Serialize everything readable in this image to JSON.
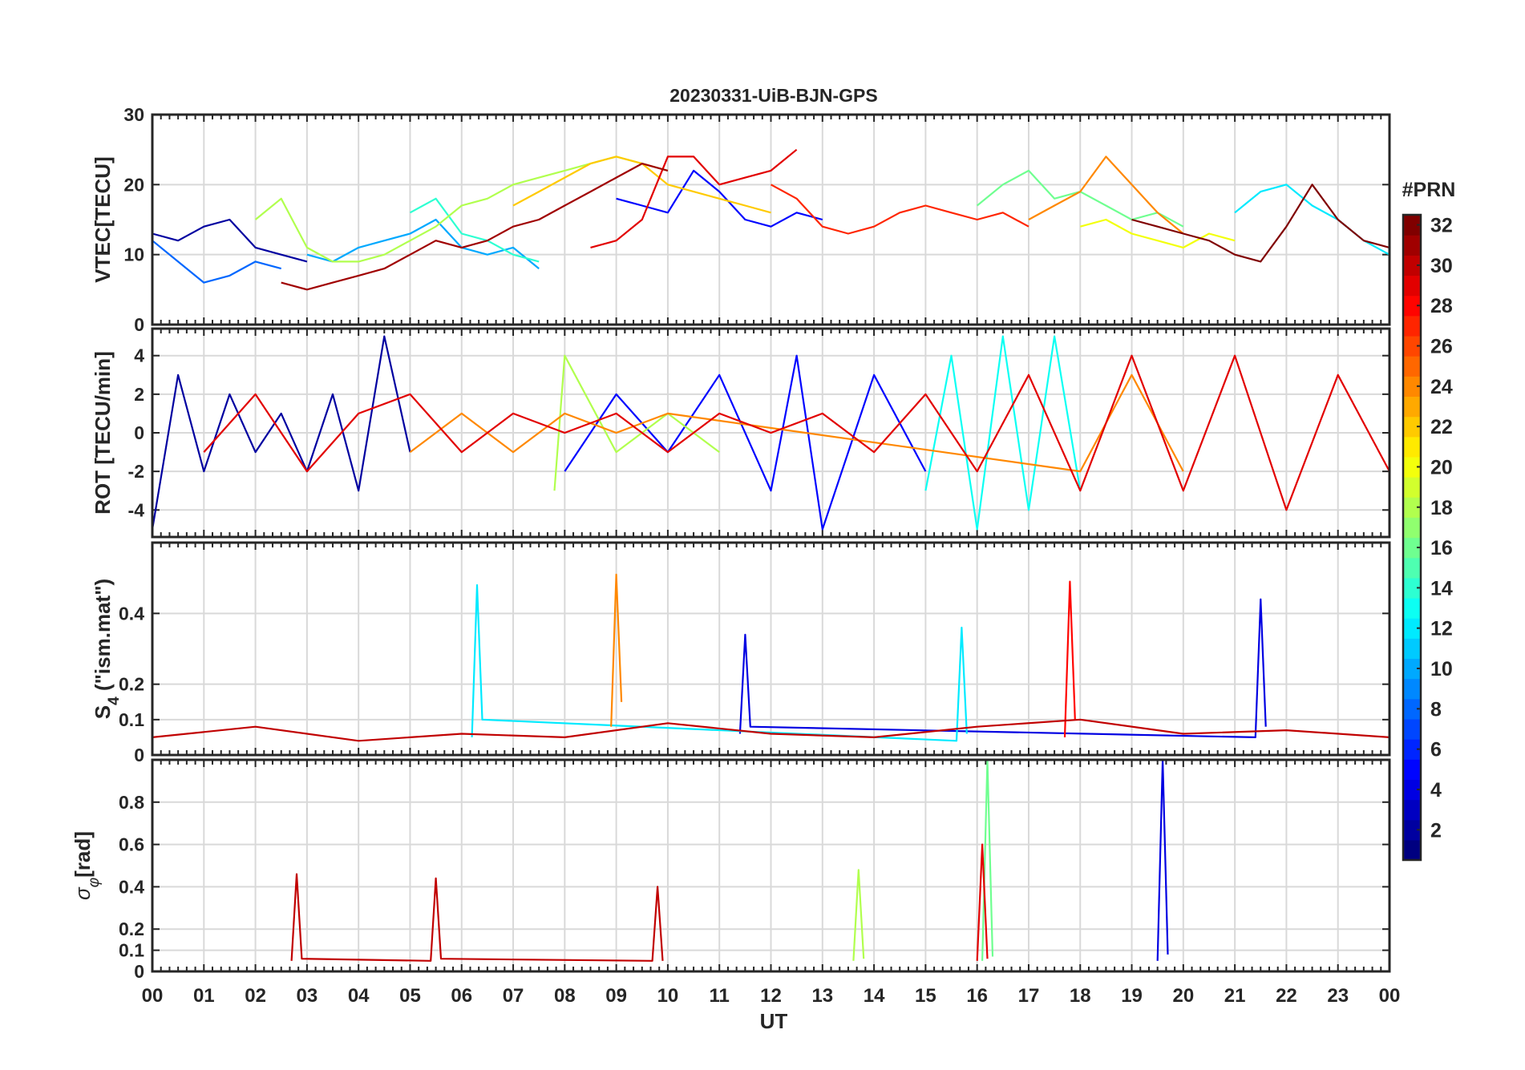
{
  "chart_data": {
    "type": "line",
    "title": "20230331-UiB-BJN-GPS",
    "xlabel": "UT",
    "x_ticks": [
      "00",
      "01",
      "02",
      "03",
      "04",
      "05",
      "06",
      "07",
      "08",
      "09",
      "10",
      "11",
      "12",
      "13",
      "14",
      "15",
      "16",
      "17",
      "18",
      "19",
      "20",
      "21",
      "22",
      "23",
      "00"
    ],
    "xlim_hours": [
      0,
      24
    ],
    "grid": true,
    "colorbar": {
      "label": "#PRN",
      "range": [
        1,
        32
      ],
      "ticks": [
        2,
        4,
        6,
        8,
        10,
        12,
        14,
        16,
        18,
        20,
        22,
        24,
        26,
        28,
        30,
        32
      ],
      "colormap": "jet",
      "levels": 32
    },
    "panels": [
      {
        "id": "vtec",
        "ylabel": "VTEC[TECU]",
        "ylim": [
          0,
          30
        ],
        "yticks": [
          0,
          10,
          20,
          30
        ],
        "series": [
          {
            "prn": 2,
            "x": [
              0,
              0.5,
              1,
              1.5,
              2,
              2.5,
              3
            ],
            "y": [
              13,
              12,
              14,
              15,
              11,
              10,
              9
            ]
          },
          {
            "prn": 5,
            "x": [
              9,
              9.5,
              10,
              10.5,
              11,
              11.5,
              12,
              12.5,
              13
            ],
            "y": [
              18,
              17,
              16,
              22,
              19,
              15,
              14,
              16,
              15
            ]
          },
          {
            "prn": 8,
            "x": [
              0,
              0.5,
              1,
              1.5,
              2,
              2.5
            ],
            "y": [
              12,
              9,
              6,
              7,
              9,
              8
            ]
          },
          {
            "prn": 10,
            "x": [
              3,
              3.5,
              4,
              4.5,
              5,
              5.5,
              6,
              6.5,
              7,
              7.5
            ],
            "y": [
              10,
              9,
              11,
              12,
              13,
              15,
              11,
              10,
              11,
              8
            ]
          },
          {
            "prn": 12,
            "x": [
              21,
              21.5,
              22,
              22.5,
              23,
              23.5,
              24
            ],
            "y": [
              16,
              19,
              20,
              17,
              15,
              12,
              10
            ]
          },
          {
            "prn": 14,
            "x": [
              5,
              5.5,
              6,
              6.5,
              7,
              7.5
            ],
            "y": [
              16,
              18,
              13,
              12,
              10,
              9
            ]
          },
          {
            "prn": 16,
            "x": [
              16,
              16.5,
              17,
              17.5,
              18,
              18.5,
              19,
              19.5,
              20
            ],
            "y": [
              17,
              20,
              22,
              18,
              19,
              17,
              15,
              16,
              14
            ]
          },
          {
            "prn": 18,
            "x": [
              2,
              2.5,
              3,
              3.5,
              4,
              4.5,
              5,
              5.5,
              6,
              6.5,
              7,
              7.5,
              8,
              8.5,
              9,
              9.5,
              10
            ],
            "y": [
              15,
              18,
              11,
              9,
              9,
              10,
              12,
              14,
              17,
              18,
              20,
              21,
              22,
              23,
              24,
              23,
              22
            ]
          },
          {
            "prn": 20,
            "x": [
              18,
              18.5,
              19,
              19.5,
              20,
              20.5,
              21
            ],
            "y": [
              14,
              15,
              13,
              12,
              11,
              13,
              12
            ]
          },
          {
            "prn": 22,
            "x": [
              7,
              7.5,
              8,
              8.5,
              9,
              9.5,
              10,
              10.5,
              11,
              11.5,
              12
            ],
            "y": [
              17,
              19,
              21,
              23,
              24,
              23,
              20,
              19,
              18,
              17,
              16
            ]
          },
          {
            "prn": 24,
            "x": [
              17,
              17.5,
              18,
              18.5,
              19,
              19.5,
              20
            ],
            "y": [
              15,
              17,
              19,
              24,
              20,
              16,
              13
            ]
          },
          {
            "prn": 27,
            "x": [
              12,
              12.5,
              13,
              13.5,
              14,
              14.5,
              15,
              15.5,
              16,
              16.5,
              17
            ],
            "y": [
              20,
              18,
              14,
              13,
              14,
              16,
              17,
              16,
              15,
              16,
              14
            ]
          },
          {
            "prn": 29,
            "x": [
              8.5,
              9,
              9.5,
              10,
              10.5,
              11,
              11.5,
              12,
              12.5
            ],
            "y": [
              11,
              12,
              15,
              24,
              24,
              20,
              21,
              22,
              25
            ]
          },
          {
            "prn": 31,
            "x": [
              2.5,
              3,
              3.5,
              4,
              4.5,
              5,
              5.5,
              6,
              6.5,
              7,
              7.5,
              8,
              8.5,
              9,
              9.5,
              10
            ],
            "y": [
              6,
              5,
              6,
              7,
              8,
              10,
              12,
              11,
              12,
              14,
              15,
              17,
              19,
              21,
              23,
              22
            ]
          },
          {
            "prn": 32,
            "x": [
              19,
              19.5,
              20,
              20.5,
              21,
              21.5,
              22,
              22.5,
              23,
              23.5,
              24
            ],
            "y": [
              15,
              14,
              13,
              12,
              10,
              9,
              14,
              20,
              15,
              12,
              11
            ]
          }
        ]
      },
      {
        "id": "rot",
        "ylabel": "ROT [TECU/min]",
        "ylim": [
          -5.4,
          5.4
        ],
        "yticks": [
          -4,
          -2,
          0,
          2,
          4
        ],
        "series": [
          {
            "prn": 2,
            "x": [
              0,
              0.5,
              1,
              1.5,
              2,
              2.5,
              3,
              3.5,
              4,
              4.5,
              5
            ],
            "y": [
              -5,
              3,
              -2,
              2,
              -1,
              1,
              -2,
              2,
              -3,
              5,
              -1
            ]
          },
          {
            "prn": 5,
            "x": [
              8,
              9,
              10,
              11,
              12,
              12.5,
              13,
              14,
              15
            ],
            "y": [
              -2,
              2,
              -1,
              3,
              -3,
              4,
              -5,
              3,
              -2
            ]
          },
          {
            "prn": 13,
            "x": [
              15,
              15.5,
              16,
              16.5,
              17,
              17.5,
              18
            ],
            "y": [
              -3,
              4,
              -5,
              5,
              -4,
              5,
              -3
            ]
          },
          {
            "prn": 18,
            "x": [
              7.8,
              8,
              9,
              10,
              11
            ],
            "y": [
              -3,
              4,
              -1,
              1,
              -1
            ]
          },
          {
            "prn": 24,
            "x": [
              5,
              6,
              7,
              8,
              9,
              10,
              18,
              19,
              20
            ],
            "y": [
              -1,
              1,
              -1,
              1,
              0,
              1,
              -2,
              3,
              -2
            ]
          },
          {
            "prn": 29,
            "x": [
              1,
              2,
              3,
              4,
              5,
              6,
              7,
              8,
              9,
              10,
              11,
              12,
              13,
              14,
              15,
              16,
              17,
              18,
              19,
              20,
              21,
              22,
              23,
              24
            ],
            "y": [
              -1,
              2,
              -2,
              1,
              2,
              -1,
              1,
              0,
              1,
              -1,
              1,
              0,
              1,
              -1,
              2,
              -2,
              3,
              -3,
              4,
              -3,
              4,
              -4,
              3,
              -2
            ]
          }
        ]
      },
      {
        "id": "s4",
        "ylabel": "S4 (\"ism.mat\")",
        "ylabel_main": "S",
        "ylabel_sub": "4",
        "ylabel_rest": " (\"ism.mat\")",
        "ylim": [
          0,
          0.6
        ],
        "yticks": [
          0,
          0.1,
          0.2,
          0.4
        ],
        "ytick_labels": [
          "0",
          "0.1",
          "0.2",
          "0.4"
        ],
        "series": [
          {
            "prn": 4,
            "x": [
              11.4,
              11.5,
              11.6,
              21.4,
              21.5,
              21.6
            ],
            "y": [
              0.06,
              0.34,
              0.08,
              0.05,
              0.44,
              0.08
            ]
          },
          {
            "prn": 12,
            "x": [
              6.2,
              6.3,
              6.4,
              15.6,
              15.7,
              15.8
            ],
            "y": [
              0.05,
              0.48,
              0.1,
              0.04,
              0.36,
              0.06
            ]
          },
          {
            "prn": 24,
            "x": [
              8.9,
              9.0,
              9.1
            ],
            "y": [
              0.08,
              0.51,
              0.15
            ]
          },
          {
            "prn": 28,
            "x": [
              17.7,
              17.8,
              17.9
            ],
            "y": [
              0.05,
              0.49,
              0.1
            ]
          },
          {
            "prn": 30,
            "x": [
              0,
              2,
              4,
              6,
              8,
              10,
              12,
              14,
              16,
              18,
              20,
              22,
              24
            ],
            "y": [
              0.05,
              0.08,
              0.04,
              0.06,
              0.05,
              0.09,
              0.06,
              0.05,
              0.08,
              0.1,
              0.06,
              0.07,
              0.05
            ]
          }
        ]
      },
      {
        "id": "sigma",
        "ylabel": "σφ[rad]",
        "ylabel_main": "σ",
        "ylabel_sub": "φ",
        "ylabel_rest": "[rad]",
        "ylim": [
          0,
          1.0
        ],
        "yticks": [
          0,
          0.1,
          0.2,
          0.4,
          0.6,
          0.8
        ],
        "ytick_labels": [
          "0",
          "0.1",
          "0.2",
          "0.4",
          "0.6",
          "0.8"
        ],
        "series": [
          {
            "prn": 4,
            "x": [
              19.5,
              19.6,
              19.7
            ],
            "y": [
              0.05,
              1.0,
              0.08
            ]
          },
          {
            "prn": 16,
            "x": [
              16.1,
              16.2,
              16.3
            ],
            "y": [
              0.05,
              1.0,
              0.07
            ]
          },
          {
            "prn": 29,
            "x": [
              16.0,
              16.1,
              16.2
            ],
            "y": [
              0.05,
              0.6,
              0.06
            ]
          },
          {
            "prn": 30,
            "x": [
              2.7,
              2.8,
              2.9,
              5.4,
              5.5,
              5.6,
              9.7,
              9.8,
              9.9
            ],
            "y": [
              0.05,
              0.46,
              0.06,
              0.05,
              0.44,
              0.06,
              0.05,
              0.4,
              0.05
            ]
          },
          {
            "prn": 18,
            "x": [
              13.6,
              13.7,
              13.8
            ],
            "y": [
              0.05,
              0.48,
              0.06
            ]
          }
        ]
      }
    ]
  }
}
